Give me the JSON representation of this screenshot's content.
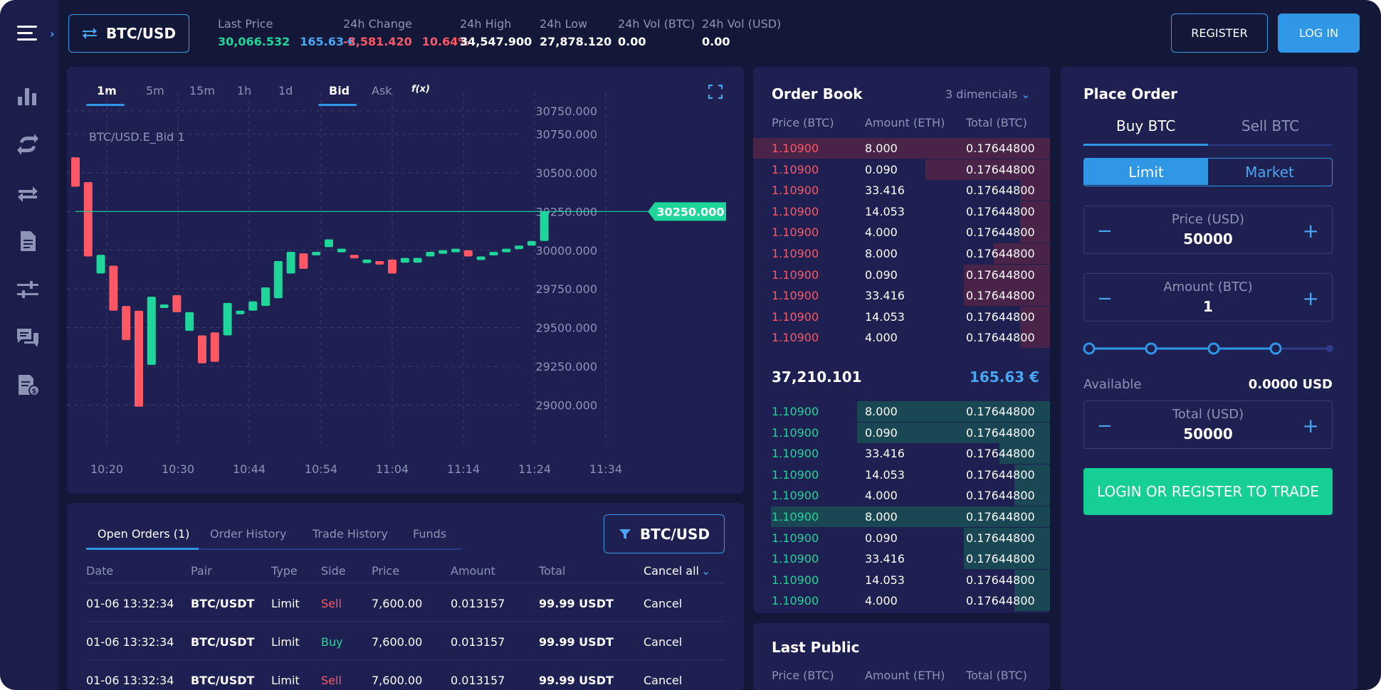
{
  "header": {
    "pair": "BTC/USD",
    "stats": [
      {
        "label": "Last Price",
        "values": [
          {
            "text": "30,066.532",
            "color": "green"
          },
          {
            "text": "165.63 €",
            "color": "blue"
          }
        ]
      },
      {
        "label": "24h Change",
        "values": [
          {
            "text": "-3,581.420",
            "color": "red"
          },
          {
            "text": "10.64%",
            "color": "red"
          }
        ]
      },
      {
        "label": "24h High",
        "values": [
          {
            "text": "34,547.900",
            "color": "white"
          }
        ]
      },
      {
        "label": "24h Low",
        "values": [
          {
            "text": "27,878.120",
            "color": "white"
          }
        ]
      },
      {
        "label": "24h Vol (BTC)",
        "values": [
          {
            "text": "0.00",
            "color": "white"
          }
        ]
      },
      {
        "label": "24h Vol (USD)",
        "values": [
          {
            "text": "0.00",
            "color": "white"
          }
        ]
      }
    ],
    "register_label": "REGISTER",
    "login_label": "LOG IN"
  },
  "sidebar": {
    "icons": [
      "bar-chart-icon",
      "exchange-cycle-icon",
      "swap-arrows-icon",
      "document-icon",
      "sliders-icon",
      "chat-icon",
      "invoice-icon"
    ]
  },
  "chart": {
    "timeframes": [
      "1m",
      "5m",
      "15m",
      "1h",
      "1d"
    ],
    "active_timeframe": "1m",
    "sides": [
      "Bid",
      "Ask"
    ],
    "active_side": "Bid",
    "indicator_label": "f(x)",
    "series_label": "BTC/USD.E_Bid  1",
    "current_price_label": "30250.000",
    "colors": {
      "up": "#1ed59a",
      "down": "#ff5764",
      "grid": "#3a3e6c",
      "panel": "#1d2050"
    }
  },
  "chart_data": {
    "type": "candlestick",
    "title": "",
    "series_name": "BTC/USD.E_Bid 1",
    "y_ticks": [
      "30750.000",
      "30750.000",
      "30500.000",
      "30250.000",
      "30000.000",
      "29750.000",
      "29500.000",
      "29250.000",
      "29000.000"
    ],
    "x_ticks": [
      "10:20",
      "10:30",
      "10:44",
      "10:54",
      "11:04",
      "11:14",
      "11:24",
      "11:34"
    ],
    "ylim": [
      28750,
      31000
    ],
    "current_price": 30250,
    "grid": true,
    "candles": [
      {
        "open": 30600,
        "close": 30410,
        "high": 30600,
        "low": 30410
      },
      {
        "open": 30440,
        "close": 29960,
        "high": 30440,
        "low": 29960
      },
      {
        "open": 29850,
        "close": 29970,
        "high": 29970,
        "low": 29850
      },
      {
        "open": 29900,
        "close": 29610,
        "high": 29900,
        "low": 29610
      },
      {
        "open": 29640,
        "close": 29420,
        "high": 29640,
        "low": 29420
      },
      {
        "open": 29610,
        "close": 28990,
        "high": 29610,
        "low": 28990
      },
      {
        "open": 29260,
        "close": 29700,
        "high": 29700,
        "low": 29260
      },
      {
        "open": 29630,
        "close": 29650,
        "high": 29650,
        "low": 29630
      },
      {
        "open": 29710,
        "close": 29600,
        "high": 29710,
        "low": 29600
      },
      {
        "open": 29480,
        "close": 29600,
        "high": 29600,
        "low": 29480
      },
      {
        "open": 29450,
        "close": 29270,
        "high": 29450,
        "low": 29270
      },
      {
        "open": 29470,
        "close": 29280,
        "high": 29470,
        "low": 29280
      },
      {
        "open": 29450,
        "close": 29660,
        "high": 29660,
        "low": 29450
      },
      {
        "open": 29600,
        "close": 29610,
        "high": 29610,
        "low": 29600
      },
      {
        "open": 29610,
        "close": 29670,
        "high": 29670,
        "low": 29610
      },
      {
        "open": 29640,
        "close": 29760,
        "high": 29760,
        "low": 29640
      },
      {
        "open": 29690,
        "close": 29930,
        "high": 29930,
        "low": 29690
      },
      {
        "open": 29850,
        "close": 29990,
        "high": 29990,
        "low": 29850
      },
      {
        "open": 29980,
        "close": 29880,
        "high": 29980,
        "low": 29880
      },
      {
        "open": 29980,
        "close": 29990,
        "high": 29990,
        "low": 29980
      },
      {
        "open": 30020,
        "close": 30070,
        "high": 30070,
        "low": 30020
      },
      {
        "open": 30000,
        "close": 30010,
        "high": 30010,
        "low": 30000
      },
      {
        "open": 29970,
        "close": 29950,
        "high": 29970,
        "low": 29950
      },
      {
        "open": 29930,
        "close": 29940,
        "high": 29940,
        "low": 29930
      },
      {
        "open": 29930,
        "close": 29920,
        "high": 29930,
        "low": 29920
      },
      {
        "open": 29940,
        "close": 29850,
        "high": 29940,
        "low": 29850
      },
      {
        "open": 29920,
        "close": 29950,
        "high": 29950,
        "low": 29920
      },
      {
        "open": 29920,
        "close": 29950,
        "high": 29950,
        "low": 29920
      },
      {
        "open": 29960,
        "close": 29990,
        "high": 29990,
        "low": 29960
      },
      {
        "open": 29990,
        "close": 30000,
        "high": 30000,
        "low": 29990
      },
      {
        "open": 30000,
        "close": 30010,
        "high": 30010,
        "low": 30000
      },
      {
        "open": 30000,
        "close": 29960,
        "high": 30000,
        "low": 29960
      },
      {
        "open": 29950,
        "close": 29960,
        "high": 29960,
        "low": 29950
      },
      {
        "open": 29980,
        "close": 29990,
        "high": 29990,
        "low": 29980
      },
      {
        "open": 29990,
        "close": 30010,
        "high": 30010,
        "low": 29990
      },
      {
        "open": 30020,
        "close": 30030,
        "high": 30030,
        "low": 30020
      },
      {
        "open": 30030,
        "close": 30060,
        "high": 30060,
        "low": 30030
      },
      {
        "open": 30060,
        "close": 30250,
        "high": 30250,
        "low": 30060
      }
    ]
  },
  "orders": {
    "tabs": [
      "Open Orders (1)",
      "Order History",
      "Trade History",
      "Funds"
    ],
    "filter_label": "BTC/USD",
    "columns": [
      "Date",
      "Pair",
      "Type",
      "Side",
      "Price",
      "Amount",
      "Total",
      "Cancel all"
    ],
    "rows": [
      {
        "date": "01-06 13:32:34",
        "pair": "BTC/USDT",
        "type": "Limit",
        "side": "Sell",
        "price": "7,600.00",
        "amount": "0.013157",
        "total": "99.99 USDT",
        "action": "Cancel"
      },
      {
        "date": "01-06 13:32:34",
        "pair": "BTC/USDT",
        "type": "Limit",
        "side": "Buy",
        "price": "7,600.00",
        "amount": "0.013157",
        "total": "99.99 USDT",
        "action": "Cancel"
      },
      {
        "date": "01-06 13:32:34",
        "pair": "BTC/USDT",
        "type": "Limit",
        "side": "Sell",
        "price": "7,600.00",
        "amount": "0.013157",
        "total": "99.99 USDT",
        "action": "Cancel"
      }
    ]
  },
  "order_book": {
    "title": "Order Book",
    "decimals_label": "3 dimencials",
    "columns": [
      "Price (BTC)",
      "Amount (ETH)",
      "Total (BTC)"
    ],
    "asks": [
      {
        "price": "1.10900",
        "amount": "8.000",
        "total": "0.17644800",
        "depth": 1.0
      },
      {
        "price": "1.10900",
        "amount": "0.090",
        "total": "0.17644800",
        "depth": 0.42
      },
      {
        "price": "1.10900",
        "amount": "33.416",
        "total": "0.17644800",
        "depth": 0.1
      },
      {
        "price": "1.10900",
        "amount": "14.053",
        "total": "0.17644800",
        "depth": 0.1
      },
      {
        "price": "1.10900",
        "amount": "4.000",
        "total": "0.17644800",
        "depth": 0.1
      },
      {
        "price": "1.10900",
        "amount": "8.000",
        "total": "0.17644800",
        "depth": 0.19
      },
      {
        "price": "1.10900",
        "amount": "0.090",
        "total": "0.17644800",
        "depth": 0.29
      },
      {
        "price": "1.10900",
        "amount": "33.416",
        "total": "0.17644800",
        "depth": 0.29
      },
      {
        "price": "1.10900",
        "amount": "14.053",
        "total": "0.17644800",
        "depth": 0.1
      },
      {
        "price": "1.10900",
        "amount": "4.000",
        "total": "0.17644800",
        "depth": 0.1
      }
    ],
    "mid_price": "37,210.101",
    "mid_price_eur": "165.63 €",
    "bids": [
      {
        "price": "1.10900",
        "amount": "8.000",
        "total": "0.17644800",
        "depth": 0.65
      },
      {
        "price": "1.10900",
        "amount": "0.090",
        "total": "0.17644800",
        "depth": 0.65
      },
      {
        "price": "1.10900",
        "amount": "33.416",
        "total": "0.17644800",
        "depth": 0.17
      },
      {
        "price": "1.10900",
        "amount": "14.053",
        "total": "0.17644800",
        "depth": 0.12
      },
      {
        "price": "1.10900",
        "amount": "4.000",
        "total": "0.17644800",
        "depth": 0.12
      },
      {
        "price": "1.10900",
        "amount": "8.000",
        "total": "0.17644800",
        "depth": 0.94
      },
      {
        "price": "1.10900",
        "amount": "0.090",
        "total": "0.17644800",
        "depth": 0.29
      },
      {
        "price": "1.10900",
        "amount": "33.416",
        "total": "0.17644800",
        "depth": 0.29
      },
      {
        "price": "1.10900",
        "amount": "14.053",
        "total": "0.17644800",
        "depth": 0.12
      },
      {
        "price": "1.10900",
        "amount": "4.000",
        "total": "0.17644800",
        "depth": 0.12
      }
    ]
  },
  "last_public": {
    "title": "Last Public",
    "columns": [
      "Price (BTC)",
      "Amount (ETH)",
      "Total (BTC)"
    ]
  },
  "place_order": {
    "title": "Place Order",
    "side_tabs": [
      "Buy BTC",
      "Sell BTC"
    ],
    "active_side": "Buy BTC",
    "order_types": [
      "Limit",
      "Market"
    ],
    "active_type": "Limit",
    "price_label": "Price (USD)",
    "price_value": "50000",
    "amount_label": "Amount (BTC)",
    "amount_value": "1",
    "slider_fraction": 0,
    "available_label": "Available",
    "available_value": "0.0000 USD",
    "total_label": "Total (USD)",
    "total_value": "50000",
    "trade_button_label": "LOGIN OR REGISTER TO TRADE"
  }
}
